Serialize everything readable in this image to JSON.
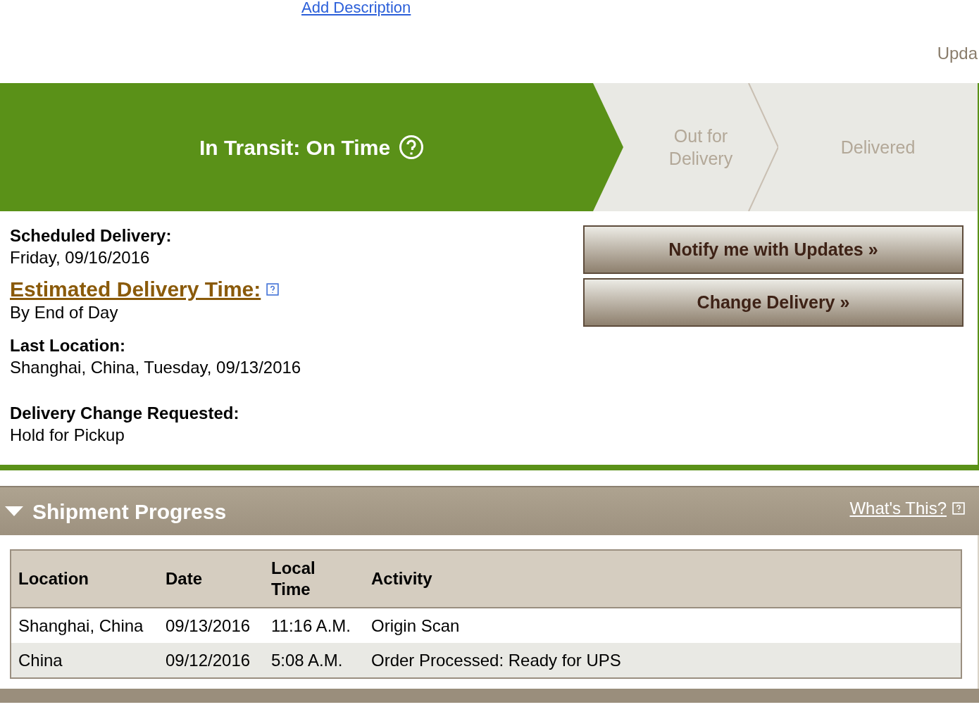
{
  "top": {
    "link": "Add Description",
    "cut_text": "Upda"
  },
  "steps": [
    {
      "label": "In Transit: On Time",
      "selected": true,
      "help": true
    },
    {
      "label": "Out for Delivery",
      "selected": false,
      "help": false
    },
    {
      "label": "Delivered",
      "selected": false,
      "help": false
    }
  ],
  "details": [
    {
      "label": "Scheduled Delivery:",
      "value": "Friday, 09/16/2016",
      "kind": "plain"
    },
    {
      "label": "Estimated Delivery Time:",
      "value": "By End of Day",
      "kind": "link"
    },
    {
      "label": "Last Location:",
      "value": "Shanghai, China, Tuesday, 09/13/2016",
      "kind": "plain"
    },
    {
      "label": "Delivery Change Requested:",
      "value": "Hold for Pickup",
      "kind": "plain"
    }
  ],
  "buttons": [
    "Notify me with Updates »",
    "Change Delivery »"
  ],
  "progress": {
    "title": "Shipment Progress",
    "expanded": true,
    "help_link": "What's This?",
    "columns": [
      "Location",
      "Date",
      "Local Time",
      "Activity"
    ],
    "rows": [
      [
        "Shanghai, China",
        "09/13/2016",
        "11:16 A.M.",
        "Origin Scan"
      ],
      [
        "China",
        "09/12/2016",
        "5:08 A.M.",
        "Order Processed: Ready for UPS"
      ]
    ]
  }
}
